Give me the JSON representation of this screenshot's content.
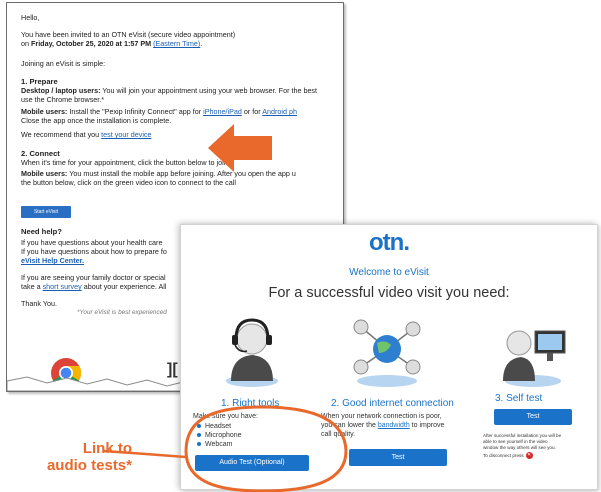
{
  "email": {
    "greeting": "Hello,",
    "invite_line1": "You have been invited to an OTN eVisit (secure video appointment)",
    "invite_on": "on ",
    "invite_date": "Friday, October 25, 2020 at 1:57 PM",
    "invite_tz": "(Eastern Time)",
    "invite_end": ".",
    "joining": "Joining an eVisit is simple:",
    "prepare_heading": "1. Prepare",
    "desktop_label": "Desktop / laptop users:",
    "desktop_text": " You will join your appointment using your web browser. For the best",
    "desktop_text2": "use the Chrome browser.*",
    "mobile_label": "Mobile users:",
    "mobile_text": " Install the \"Pexip Infinity Connect\" app for ",
    "mobile_link1": "iPhone/iPad",
    "mobile_or": " or for ",
    "mobile_link2": "Android ph",
    "mobile_text2": "Close the app once the installation is complete.",
    "recommend_text": "We recommend that you ",
    "recommend_link": "test your device",
    "connect_heading": "2. Connect",
    "connect_text": "When it's time for your appointment, click the button below to join.",
    "mobile2_label": "Mobile users:",
    "mobile2_text": " You must install the mobile app before joining. After you open the app u",
    "mobile2_text2": "the button below, click on the green video icon to connect to the call",
    "start_button": "Start eVisit",
    "help_heading": "Need help?",
    "help_text1": "If you have questions about your health care",
    "help_text2": "If you have questions about how to prepare fo",
    "help_link": "eVisit Help Center.",
    "family_text": "If you are seeing your family doctor or special",
    "survey_pre": "take a ",
    "survey_link": "short survey",
    "survey_post": " about your experience. All",
    "thanks": "Thank You.",
    "disclaimer": "*Your eVisit is best experienced",
    "ie_glyph": "][",
    "chrome_icon": "chrome-logo",
    "link_color": "#1a5fb4"
  },
  "panel": {
    "logo_text": "otn.",
    "welcome": "Welcome to eVisit",
    "headline": "For a successful video visit you need:",
    "steps": [
      {
        "title": "1. Right tools",
        "intro": "Make sure you have:",
        "items": [
          "Headset",
          "Microphone",
          "Webcam"
        ],
        "button": "Audio Test (Optional)",
        "icon": "headset-person-icon"
      },
      {
        "title": "2. Good internet connection",
        "text1": "When your network connection is poor,",
        "text2_pre": "you can lower the ",
        "text2_link": "bandwidth",
        "text2_post": " to improve",
        "text3": "call quality.",
        "button": "Test",
        "icon": "network-globe-icon"
      },
      {
        "title": "3. Self test",
        "button": "Test",
        "note1": "After successful installation you will be",
        "note2": "able to see yourself in the video",
        "note3": "window the way others will see you.",
        "note4": "To disconnect press",
        "icon": "person-at-computer-icon"
      }
    ],
    "accent_color": "#1b73c9"
  },
  "callout": {
    "line1": "Link to",
    "line2": "audio tests*",
    "color": "#e8692b"
  }
}
